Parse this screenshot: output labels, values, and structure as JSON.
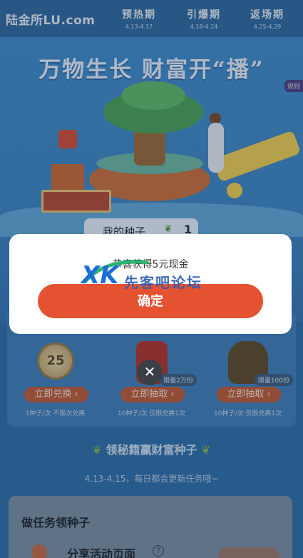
{
  "topbar": {
    "logo": "陆金所LU.com",
    "phases": [
      {
        "name": "预热期",
        "date": "4.13-4.17"
      },
      {
        "name": "引爆期",
        "date": "4.18-4.24"
      },
      {
        "name": "返场期",
        "date": "4.25-4.29"
      }
    ]
  },
  "hero": {
    "headline": "万物生长 财富开“播”",
    "badge": "规则",
    "sign_text": "🌱 🌱 🌱"
  },
  "seeds": {
    "label": "我的种子",
    "icon": "sprout-icon",
    "count": "1"
  },
  "prizes": [
    {
      "image": "coupon-coin",
      "value": "25",
      "button": "立即兑换 ›",
      "note": "1种子/次 不限次兑换",
      "limit": ""
    },
    {
      "image": "red-gift",
      "value": "",
      "button": "立即抽取 ›",
      "note": "10种子/次 仅限兑换1次",
      "limit": "限量2万份"
    },
    {
      "image": "nuts",
      "value": "",
      "button": "立即抽取 ›",
      "note": "10种子/次 仅限兑换1次",
      "limit": "限量100份"
    }
  ],
  "section": {
    "title": "领秘籍赢财富种子",
    "subtitle": "4.13-4.15，每日都会更新任务哦~"
  },
  "tasks": {
    "heading": "做任务领种子",
    "item_name": "分享活动页面",
    "help": "?"
  },
  "modal": {
    "message": "恭喜获得5元现金",
    "confirm_label": "确定",
    "close_symbol": "✕"
  },
  "watermark": {
    "logo": "XK",
    "text": "先客吧论坛"
  },
  "colors": {
    "accent": "#e55232",
    "page_bg": "#2b6fae",
    "modal_bg": "#ffffff"
  }
}
